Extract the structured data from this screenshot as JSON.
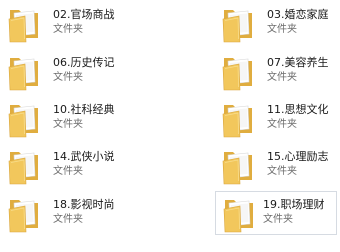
{
  "explorer": {
    "items": [
      {
        "name": "02.官场商战",
        "type": "文件夹"
      },
      {
        "name": "03.婚恋家庭",
        "type": "文件夹"
      },
      {
        "name": "06.历史传记",
        "type": "文件夹"
      },
      {
        "name": "07.美容养生",
        "type": "文件夹"
      },
      {
        "name": "10.社科经典",
        "type": "文件夹"
      },
      {
        "name": "11.思想文化",
        "type": "文件夹"
      },
      {
        "name": "14.武侠小说",
        "type": "文件夹"
      },
      {
        "name": "15.心理励志",
        "type": "文件夹"
      },
      {
        "name": "18.影视时尚",
        "type": "文件夹"
      },
      {
        "name": "19.职场理财",
        "type": "文件夹"
      }
    ],
    "selected_item": "19.职场理财",
    "icon": "folder-icon",
    "colors": {
      "folder_front": "#f2c75c",
      "folder_back": "#e0ad3f",
      "paper": "#ffffff",
      "selection_border": "#d6dbe2"
    }
  }
}
